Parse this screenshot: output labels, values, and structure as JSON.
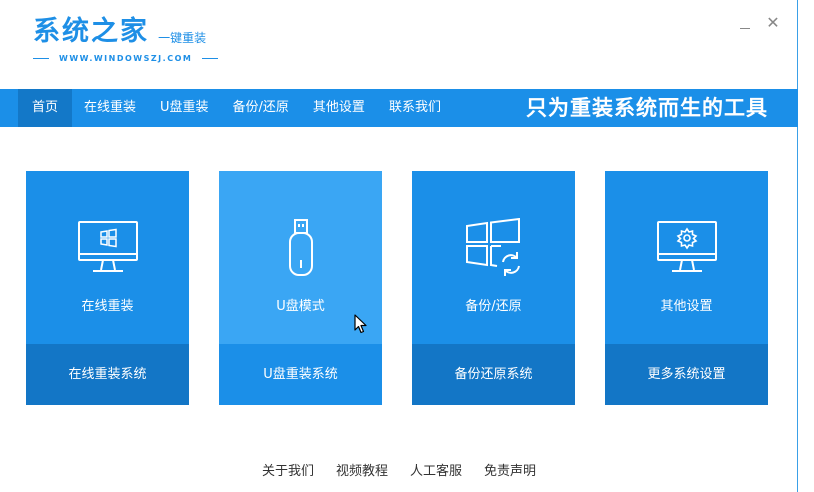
{
  "header": {
    "logo_main": "系统之家",
    "logo_sub": "一键重装",
    "logo_url": "WWW.WINDOWSZJ.COM"
  },
  "window": {
    "minimize_icon": "minimize-icon",
    "close_icon": "close-icon",
    "close_glyph": "✕"
  },
  "nav": {
    "items": [
      {
        "label": "首页"
      },
      {
        "label": "在线重装"
      },
      {
        "label": "U盘重装"
      },
      {
        "label": "备份/还原"
      },
      {
        "label": "其他设置"
      },
      {
        "label": "联系我们"
      }
    ],
    "slogan": "只为重装系统而生的工具"
  },
  "cards": [
    {
      "title": "在线重装",
      "footer": "在线重装系统",
      "icon": "monitor-windows-icon"
    },
    {
      "title": "U盘模式",
      "footer": "U盘重装系统",
      "icon": "usb-drive-icon"
    },
    {
      "title": "备份/还原",
      "footer": "备份还原系统",
      "icon": "windows-restore-icon"
    },
    {
      "title": "其他设置",
      "footer": "更多系统设置",
      "icon": "monitor-gear-icon"
    }
  ],
  "footer": {
    "links": [
      {
        "label": "关于我们"
      },
      {
        "label": "视频教程"
      },
      {
        "label": "人工客服"
      },
      {
        "label": "免责声明"
      }
    ]
  },
  "colors": {
    "brand": "#1b8fe8",
    "card_footer": "#1376c6",
    "card_hover": "#3aa6f4"
  }
}
